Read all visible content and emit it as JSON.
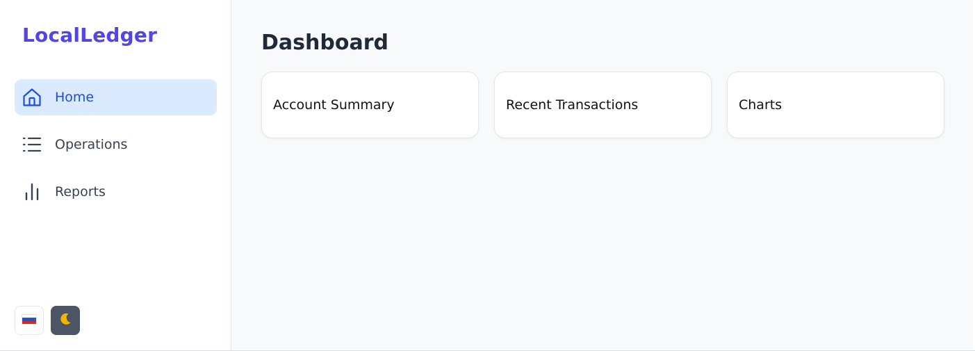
{
  "app": {
    "brand": "LocalLedger",
    "colors": {
      "brand": "#4f46e5",
      "active_bg": "#dbeafe",
      "active_text": "#1d4ed8",
      "theme_button_bg": "#4b5563"
    }
  },
  "sidebar": {
    "items": [
      {
        "label": "Home",
        "icon": "home-icon",
        "active": true
      },
      {
        "label": "Operations",
        "icon": "list-icon",
        "active": false
      },
      {
        "label": "Reports",
        "icon": "bar-chart-icon",
        "active": false
      }
    ],
    "language_icon": "russia-flag-icon",
    "theme_icon": "moon-icon"
  },
  "main": {
    "title": "Dashboard",
    "cards": [
      {
        "title": "Account Summary"
      },
      {
        "title": "Recent Transactions"
      },
      {
        "title": "Charts"
      }
    ]
  }
}
